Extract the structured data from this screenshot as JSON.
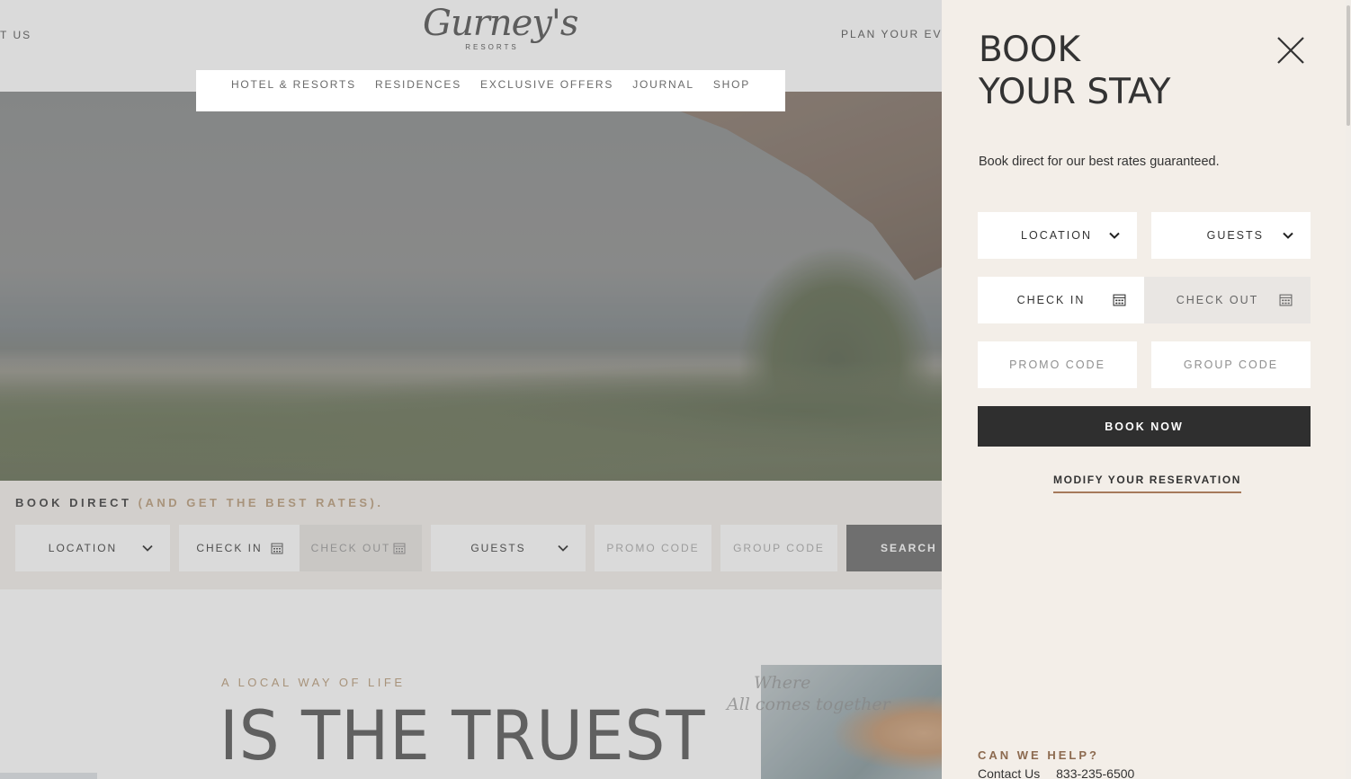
{
  "header": {
    "left_link": "T US",
    "right_link": "PLAN YOUR EVE",
    "logo": {
      "name": "Gurney's",
      "sub": "RESORTS"
    },
    "nav": [
      "HOTEL & RESORTS",
      "RESIDENCES",
      "EXCLUSIVE OFFERS",
      "JOURNAL",
      "SHOP"
    ]
  },
  "bookbar": {
    "title": "BOOK DIRECT",
    "title_accent": "(AND GET THE BEST RATES).",
    "location": "LOCATION",
    "check_in": "CHECK IN",
    "check_out": "CHECK OUT",
    "guests": "GUESTS",
    "promo_code": "PROMO CODE",
    "group_code": "GROUP CODE",
    "search": "SEARCH"
  },
  "content": {
    "kicker": "A LOCAL WAY OF LIFE",
    "heading": "IS THE TRUEST",
    "script_line1": "Where",
    "script_line2": "All comes together"
  },
  "panel": {
    "title_line1": "BOOK",
    "title_line2": "YOUR STAY",
    "subtitle": "Book direct for our best rates guaranteed.",
    "location": "LOCATION",
    "guests": "GUESTS",
    "check_in": "CHECK IN",
    "check_out": "CHECK OUT",
    "promo_code": "PROMO CODE",
    "group_code": "GROUP CODE",
    "book_now": "BOOK NOW",
    "modify": "MODIFY YOUR RESERVATION",
    "help_title": "CAN WE HELP?",
    "contact_label": "Contact Us",
    "phone": "833-235-6500"
  },
  "colors": {
    "panel_bg": "#f3eee8",
    "accent_gold": "#c2a98b",
    "underline_brown": "#a5795a",
    "button_dark": "#2f2f2f"
  },
  "icons": [
    "chevron-down-icon",
    "calendar-icon",
    "close-icon"
  ]
}
